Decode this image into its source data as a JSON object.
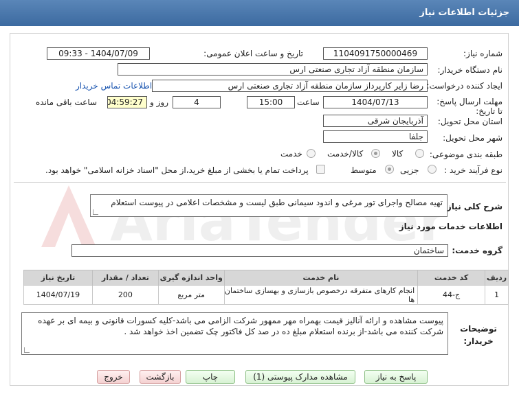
{
  "header": {
    "title": "جزئیات اطلاعات نیاز"
  },
  "need_number": {
    "label": "شماره نیاز:",
    "value": "1104091750000469"
  },
  "announce_date": {
    "label": "تاریخ و ساعت اعلان عمومی:",
    "value": "1404/07/09 - 09:33"
  },
  "buyer_org": {
    "label": "نام دستگاه خریدار:",
    "value": "سازمان منطقه آزاد تجاری صنعتی ارس"
  },
  "requester": {
    "label": "ایجاد کننده درخواست:",
    "value": "رضا زایر کارپرداز سازمان منطقه آزاد تجاری صنعتی ارس",
    "contact_link": "اطلاعات تماس خریدار"
  },
  "deadline": {
    "label": "مهلت ارسال پاسخ: تا تاریخ:",
    "date": "1404/07/13",
    "time_label": "ساعت",
    "time": "15:00",
    "days": "4",
    "days_label": "روز و",
    "remaining": "04:59:27",
    "remaining_label": "ساعت باقی مانده"
  },
  "province": {
    "label": "استان محل تحویل:",
    "value": "آذربایجان شرقی"
  },
  "city": {
    "label": "شهر محل تحویل:",
    "value": "جلفا"
  },
  "category": {
    "label": "طبقه بندی موضوعی:",
    "options": [
      "کالا",
      "کالا/خدمت",
      "خدمت"
    ],
    "selected": "کالا/خدمت"
  },
  "process": {
    "label": "نوع فرآیند خرید :",
    "options": [
      "جزیی",
      "متوسط"
    ],
    "selected": "متوسط",
    "treasury_note": "پرداخت تمام یا بخشی از مبلغ خرید،از محل \"اسناد خزانه اسلامی\" خواهد بود."
  },
  "description": {
    "label": "شرح کلی نیاز:",
    "value": "تهیه مصالح واجرای تور مرغی و اندود سیمانی طبق لیست و مشخصات اعلامی در پیوست استعلام"
  },
  "services_title": "اطلاعات خدمات مورد نیاز",
  "service_group": {
    "label": "گروه خدمت:",
    "value": "ساختمان"
  },
  "table": {
    "headers": [
      "ردیف",
      "کد خدمت",
      "نام خدمت",
      "واحد اندازه گیری",
      "تعداد / مقدار",
      "تاریخ نیاز"
    ],
    "rows": [
      [
        "1",
        "ج-44",
        "انجام کارهای متفرقه درخصوص بازسازی و بهسازی ساختمان ها",
        "متر مربع",
        "200",
        "1404/07/19"
      ]
    ]
  },
  "buyer_notes": {
    "label": "توضیحات خریدار:",
    "value": "پیوست مشاهده و ارائه آنالیز قیمت بهمراه مهر ممهور شرکت الزامی می باشد-کلیه کسورات قانونی و بیمه ای بر عهده شرکت کننده می باشد-از برنده استعلام مبلغ ده در صد کل فاکتور چک تضمین اخذ خواهد شد ."
  },
  "buttons": {
    "respond": "پاسخ به نیاز",
    "view_docs": "مشاهده مدارک پیوستی (1)",
    "print": "چاپ",
    "back": "بازگشت",
    "exit": "خروج"
  },
  "watermark": "AriaTender.net"
}
